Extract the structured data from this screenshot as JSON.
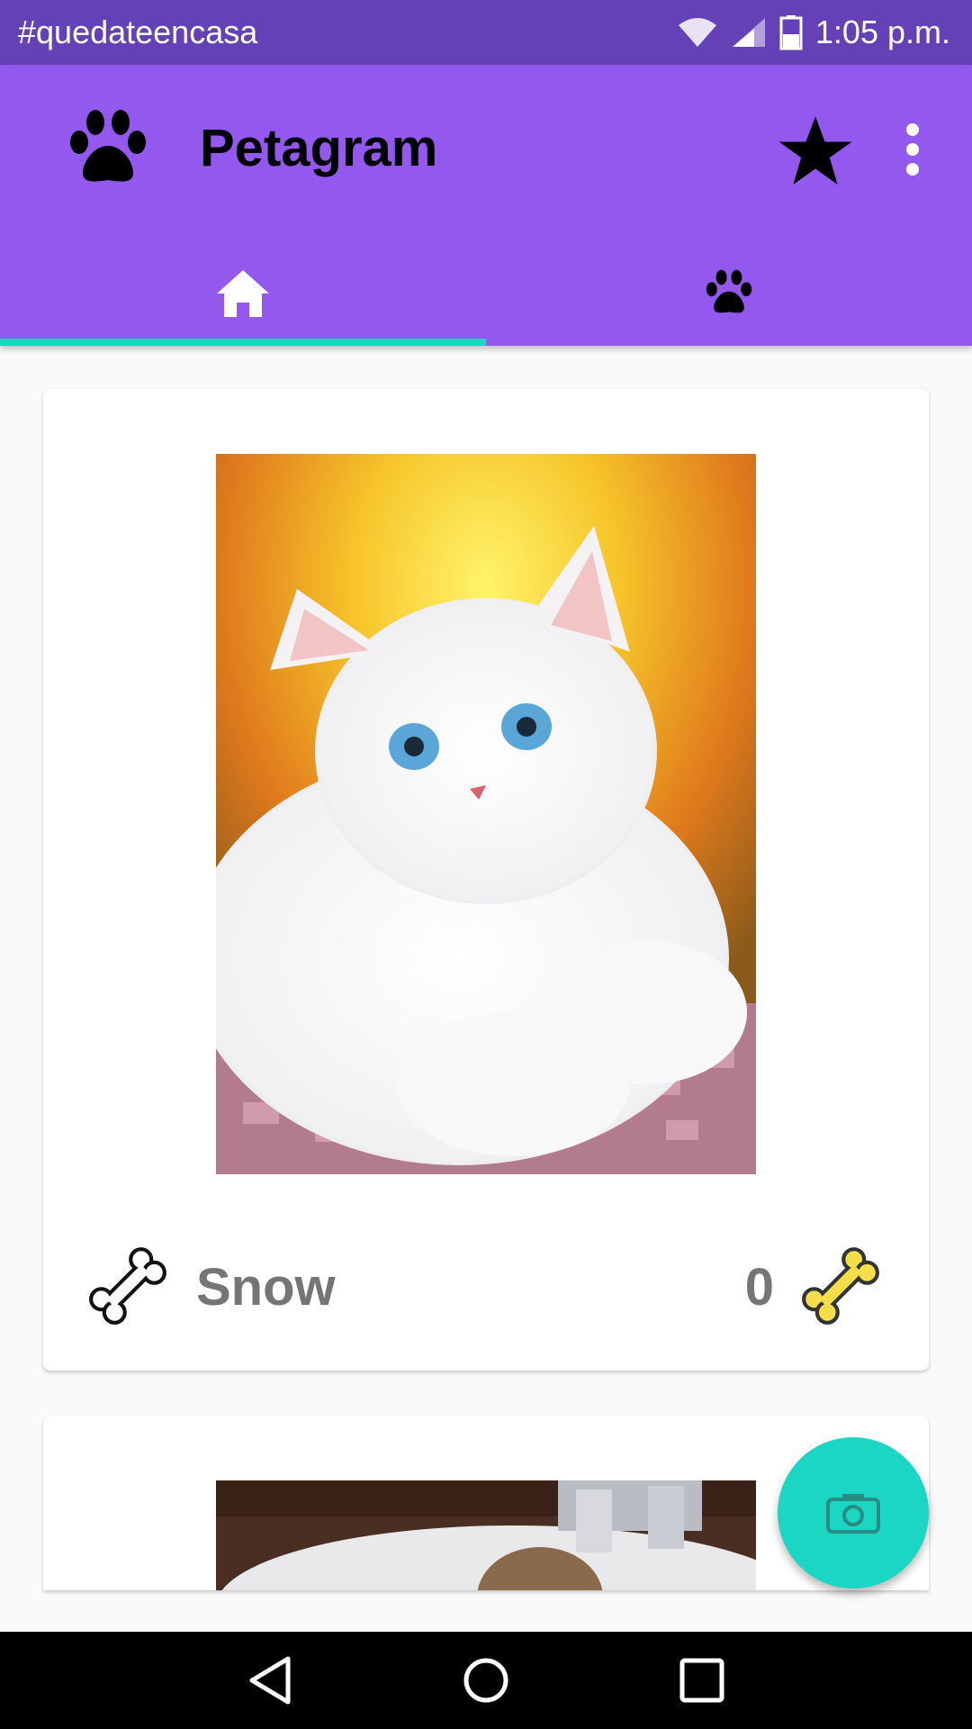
{
  "status_bar": {
    "carrier_text": "#quedateencasa",
    "time": "1:05 p.m.",
    "icons": [
      "wifi-icon",
      "signal-icon",
      "battery-icon"
    ]
  },
  "app_bar": {
    "title": "Petagram",
    "logo_icon": "paw-icon",
    "actions": [
      "star-icon",
      "more-vert-icon"
    ]
  },
  "tabs": [
    {
      "icon": "home-icon",
      "selected": true
    },
    {
      "icon": "paw-icon",
      "selected": false
    }
  ],
  "cards": [
    {
      "name": "Snow",
      "likes": "0",
      "photo": "white-cat-photo"
    },
    {
      "photo": "kitten-in-sink-photo"
    }
  ],
  "fab": {
    "icon": "camera-icon"
  },
  "nav_bar": [
    "back-icon",
    "home-circle-icon",
    "recents-icon"
  ],
  "colors": {
    "status_bar": "#6441b6",
    "app_bar": "#9359ef",
    "accent": "#1ad6c3",
    "liked_bone": "#f4de4a"
  }
}
